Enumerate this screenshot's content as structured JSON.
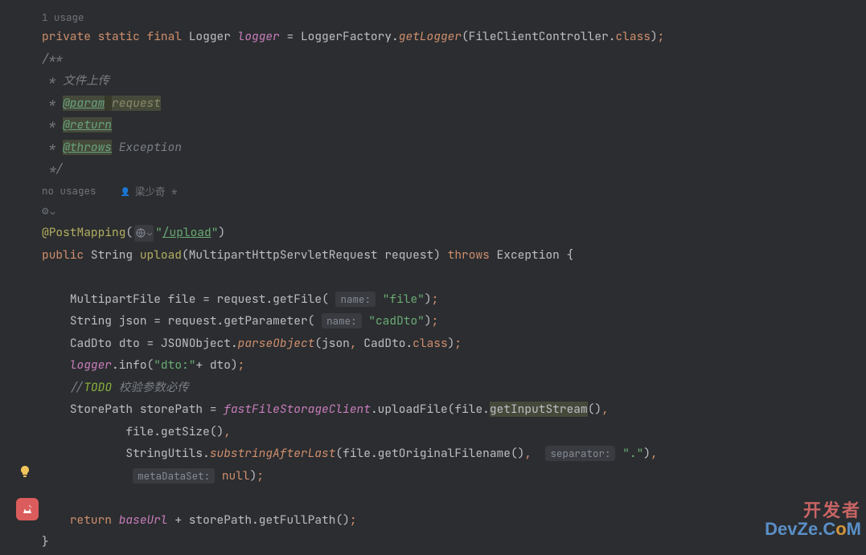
{
  "usage": "1 usage",
  "line_logger": {
    "private": "private",
    "static": "static",
    "final": "final",
    "type": "Logger",
    "field": "logger",
    "eq": " = ",
    "factory": "LoggerFactory",
    "dot1": ".",
    "getLogger": "getLogger",
    "lp": "(",
    "controller": "FileClientController",
    "dot2": ".",
    "class": "class",
    "rp": ")",
    "semi": ";"
  },
  "javadoc": {
    "open": "/**",
    "l1": " * 文件上传",
    "l2_star": " * ",
    "l2_tag": "@param",
    "l2_sp": " ",
    "l2_param": "request",
    "l3_star": " * ",
    "l3_tag": "@return",
    "l4_star": " * ",
    "l4_tag": "@throws",
    "l4_sp": " ",
    "l4_exc": "Exception",
    "close": " */"
  },
  "no_usage": "no usages",
  "author": "梁少奇 *",
  "annotation_line": {
    "anno": "@PostMapping",
    "lp": "(",
    "path": "\"",
    "path_mid": "/upload",
    "path_end": "\"",
    "rp": ")"
  },
  "method_sig": {
    "public": "public",
    "ret": "String",
    "name": "upload",
    "lp": "(",
    "ptype": "MultipartHttpServletRequest",
    "pname": "request",
    "rp": ")",
    "throws": "throws",
    "exc": "Exception",
    "brace": " {"
  },
  "body": {
    "l1": {
      "type": "MultipartFile",
      "var": "file",
      "eq": " = ",
      "obj": "request",
      "dot": ".",
      "method": "getFile",
      "lp": "(",
      "hint": "name:",
      "val": "\"file\"",
      "rp": ")",
      "semi": ";"
    },
    "l2": {
      "type": "String",
      "var": "json",
      "eq": " = ",
      "obj": "request",
      "dot": ".",
      "method": "getParameter",
      "lp": "(",
      "hint": "name:",
      "val": "\"cadDto\"",
      "rp": ")",
      "semi": ";"
    },
    "l3": {
      "type": "CadDto",
      "var": "dto",
      "eq": " = ",
      "obj": "JSONObject",
      "dot": ".",
      "method": "parseObject",
      "lp": "(",
      "a1": "json",
      "comma": ", ",
      "a2": "CadDto",
      "dot2": ".",
      "class": "class",
      "rp": ")",
      "semi": ";"
    },
    "l4": {
      "logger": "logger",
      "dot": ".",
      "method": "info",
      "lp": "(",
      "str": "\"dto:\"",
      "plus": "+ ",
      "var": "dto",
      "rp": ")",
      "semi": ";"
    },
    "l5": {
      "comment": "//",
      "todo": "TODO",
      "text": " 校验参数必传"
    },
    "l6": {
      "type": "StorePath",
      "var": "storePath",
      "eq": " = ",
      "client": "fastFileStorageClient",
      "dot": ".",
      "method": "uploadFile",
      "lp": "(",
      "a1": "file",
      "dot2": ".",
      "gis": "getInputStream",
      "lp2": "()",
      "comma": ","
    },
    "l7": {
      "a1": "file",
      "dot": ".",
      "method": "getSize",
      "pp": "()",
      "comma": ","
    },
    "l8": {
      "obj": "StringUtils",
      "dot": ".",
      "method": "substringAfterLast",
      "lp": "(",
      "a1": "file",
      "dot2": ".",
      "m2": "getOriginalFilename",
      "pp": "()",
      "comma": ", ",
      "hint": "separator:",
      "val": "\".\"",
      "rp": ")",
      "comma2": ","
    },
    "l9": {
      "hint": "metaDataSet:",
      "val": "null",
      "rp": ")",
      "semi": ";"
    },
    "ret": {
      "return": "return",
      "base": "baseUrl",
      "plus": " + ",
      "sp": "storePath",
      "dot": ".",
      "method": "getFullPath",
      "pp": "()",
      "semi": ";"
    },
    "close": "}"
  },
  "watermark": {
    "l1": "开发者",
    "l2a": "DevZe.C",
    "l2b": "o",
    "l2c": "M"
  }
}
